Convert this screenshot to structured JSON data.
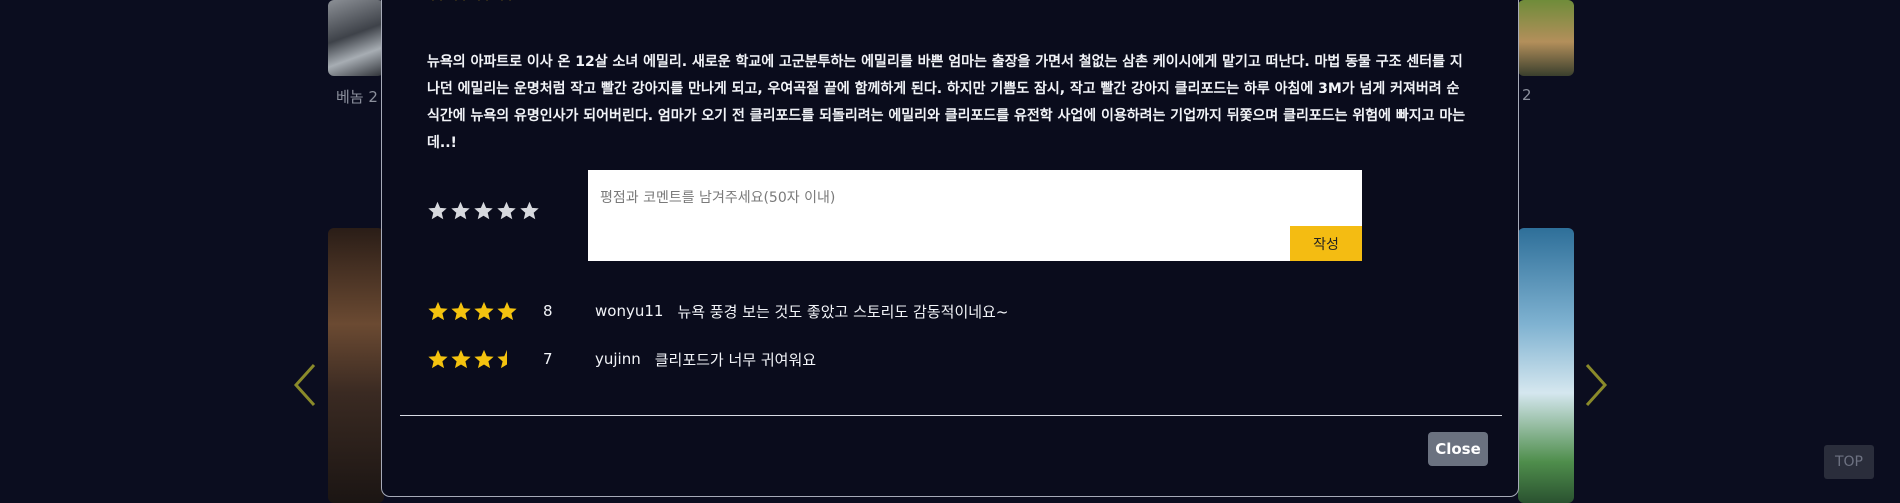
{
  "colors": {
    "background": "#0b0d1f",
    "modal_bg": "#0a0c1c",
    "star_filled": "#f4c30f",
    "star_empty": "#d7d9de",
    "submit_bg": "#f4bc12",
    "close_bg": "#6b7280",
    "arrow_color": "#8a8a2a"
  },
  "background": {
    "left_title": "베놈 2",
    "right_title": "2",
    "top_button": "TOP",
    "prev_icon": "chevron-left-icon",
    "next_icon": "chevron-right-icon"
  },
  "modal": {
    "synopsis": "뉴욕의 아파트로 이사 온 12살 소녀 에밀리. 새로운 학교에 고군분투하는 에밀리를 바쁜 엄마는 출장을 가면서 철없는 삼촌 케이시에게 맡기고 떠난다. 마법 동물 구조 센터를 지나던 에밀리는 운명처럼 작고 빨간 강아지를 만나게 되고, 우여곡절 끝에 함께하게 된다. 하지만 기쁨도 잠시, 작고 빨간 강아지 클리포드는 하루 아침에 3M가 넘게 커져버려 순식간에 뉴욕의 유명인사가 되어버린다. 엄마가 오기 전 클리포드를 되돌리려는 에밀리와 클리포드를 유전학 사업에 이용하려는 기업까지 뒤쫓으며 클리포드는 위험에 빠지고 마는데..!",
    "rating_input": {
      "selected": 0,
      "max": 5
    },
    "comment_placeholder": "평점과 코멘트를 남겨주세요(50자 이내)",
    "comment_value": "",
    "submit_label": "작성",
    "reviews": [
      {
        "stars": 4,
        "score": "8",
        "user": "wonyu11",
        "text": "뉴욕 풍경 보는 것도 좋았고 스토리도 감동적이네요~"
      },
      {
        "stars": 3.5,
        "score": "7",
        "user": "yujinn",
        "text": "클리포드가 너무 귀여워요"
      }
    ],
    "close_label": "Close"
  }
}
